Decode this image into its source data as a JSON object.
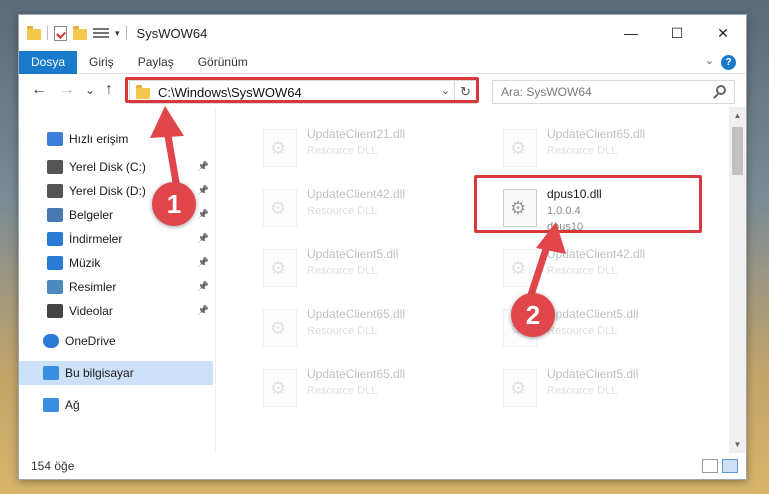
{
  "window": {
    "title": "SysWOW64",
    "controls": {
      "minimize": "—",
      "maximize": "☐",
      "close": "✕"
    }
  },
  "ribbon": {
    "tabs": [
      "Dosya",
      "Giriş",
      "Paylaş",
      "Görünüm"
    ],
    "active_tab": "Dosya",
    "help": "?"
  },
  "nav": {
    "back": "←",
    "forward": "→",
    "recent": "⌄",
    "up": "↑",
    "address": "C:\\Windows\\SysWOW64",
    "search_placeholder": "Ara: SysWOW64"
  },
  "sidebar": {
    "items": [
      {
        "label": "Hızlı erişim",
        "icon": "star-icon",
        "pinned": false
      },
      {
        "label": "Yerel Disk (C:)",
        "icon": "drive-icon",
        "pinned": true
      },
      {
        "label": "Yerel Disk (D:)",
        "icon": "drive-icon",
        "pinned": true
      },
      {
        "label": "Belgeler",
        "icon": "documents-icon",
        "pinned": true
      },
      {
        "label": "İndirmeler",
        "icon": "download-icon",
        "pinned": true
      },
      {
        "label": "Müzik",
        "icon": "music-icon",
        "pinned": true
      },
      {
        "label": "Resimler",
        "icon": "pictures-icon",
        "pinned": true
      },
      {
        "label": "Videolar",
        "icon": "video-icon",
        "pinned": true
      },
      {
        "label": "OneDrive",
        "icon": "cloud-icon",
        "pinned": false
      },
      {
        "label": "Bu bilgisayar",
        "icon": "computer-icon",
        "pinned": false,
        "selected": true
      },
      {
        "label": "Ağ",
        "icon": "network-icon",
        "pinned": false
      }
    ]
  },
  "files": [
    {
      "name": "UpdateClient21.dll",
      "type": "Resource DLL",
      "faded": true
    },
    {
      "name": "UpdateClient65.dll",
      "type": "Resource DLL",
      "faded": true
    },
    {
      "name": "UpdateClient42.dll",
      "type": "Resource DLL",
      "faded": true
    },
    {
      "name": "dpus10.dll",
      "type": "1.0.0.4",
      "extra": "dpus10",
      "faded": false,
      "highlighted": true
    },
    {
      "name": "UpdateClient5.dll",
      "type": "Resource DLL",
      "faded": true
    },
    {
      "name": "UpdateClient42.dll",
      "type": "Resource DLL",
      "faded": true
    },
    {
      "name": "UpdateClient65.dll",
      "type": "Resource DLL",
      "faded": true
    },
    {
      "name": "UpdateClient5.dll",
      "type": "Resource DLL",
      "faded": true
    },
    {
      "name": "UpdateClient65.dll",
      "type": "Resource DLL",
      "faded": true
    },
    {
      "name": "UpdateClient5.dll",
      "type": "Resource DLL",
      "faded": true
    }
  ],
  "status": {
    "item_count": "154 öğe"
  },
  "annotations": {
    "step1": "1",
    "step2": "2",
    "color": "#e0464a"
  }
}
